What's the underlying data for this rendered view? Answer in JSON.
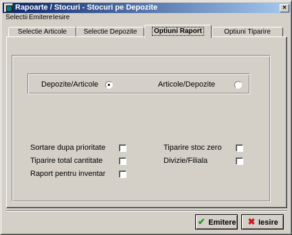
{
  "window": {
    "title": "Rapoarte / Stocuri - Stocuri pe Depozite",
    "close_glyph": "×"
  },
  "menu": [
    "Selectii",
    "Emitere",
    "Iesire"
  ],
  "tabs": [
    {
      "label": "Selectie Articole",
      "active": false
    },
    {
      "label": "Selectie Depozite",
      "active": false
    },
    {
      "label": "Optiuni Raport",
      "active": true
    },
    {
      "label": "Optiuni Tiparire",
      "active": false
    }
  ],
  "report_order": {
    "options": [
      {
        "label": "Depozite/Articole",
        "selected": true
      },
      {
        "label": "Articole/Depozite",
        "selected": false
      }
    ]
  },
  "options_left": [
    {
      "label": "Sortare dupa prioritate",
      "checked": false
    },
    {
      "label": "Tiparire total cantitate",
      "checked": false
    },
    {
      "label": "Raport pentru inventar",
      "checked": false
    }
  ],
  "options_right": [
    {
      "label": "Tiparire stoc zero",
      "checked": false
    },
    {
      "label": "Divizie/Filiala",
      "checked": false
    }
  ],
  "buttons": {
    "emitere": {
      "label": "Emitere",
      "icon": "check-icon"
    },
    "iesire": {
      "label": "Iesire",
      "icon": "cross-icon"
    }
  },
  "colors": {
    "titlebar_start": "#0a246a",
    "titlebar_end": "#a6caf0",
    "face": "#d4d0c8"
  }
}
